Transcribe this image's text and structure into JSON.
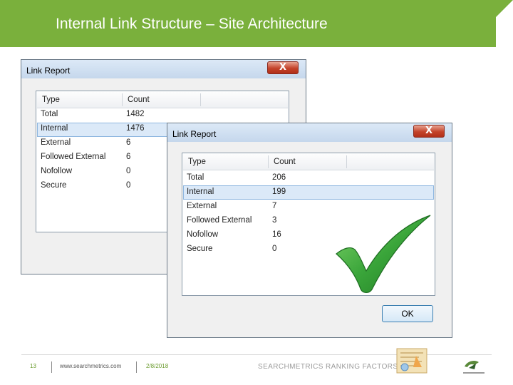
{
  "slide": {
    "title": "Internal Link Structure – Site Architecture",
    "accent_color": "#7ab03c"
  },
  "dialog_back": {
    "title": "Link Report",
    "close_label": "X",
    "columns": [
      "Type",
      "Count"
    ],
    "rows": [
      {
        "type": "Total",
        "count": "1482"
      },
      {
        "type": "Internal",
        "count": "1476"
      },
      {
        "type": "External",
        "count": "6"
      },
      {
        "type": "Followed External",
        "count": "6"
      },
      {
        "type": "Nofollow",
        "count": "0"
      },
      {
        "type": "Secure",
        "count": "0"
      }
    ],
    "selected_row": 1
  },
  "dialog_front": {
    "title": "Link Report",
    "close_label": "X",
    "ok_label": "OK",
    "columns": [
      "Type",
      "Count"
    ],
    "rows": [
      {
        "type": "Total",
        "count": "206"
      },
      {
        "type": "Internal",
        "count": "199"
      },
      {
        "type": "External",
        "count": "7"
      },
      {
        "type": "Followed External",
        "count": "3"
      },
      {
        "type": "Nofollow",
        "count": "16"
      },
      {
        "type": "Secure",
        "count": "0"
      }
    ],
    "selected_row": 1
  },
  "checkmark": {
    "icon": "checkmark-icon",
    "color": "#3aa53a"
  },
  "footer": {
    "page_number": "13",
    "website": "www.searchmetrics.com",
    "date": "2/8/2018",
    "brand_text": "SEARCHMETRICS RANKING FACTORS 2014",
    "icons": [
      "ranking-factors-illustration-icon",
      "searchmetrics-logo-icon"
    ]
  }
}
